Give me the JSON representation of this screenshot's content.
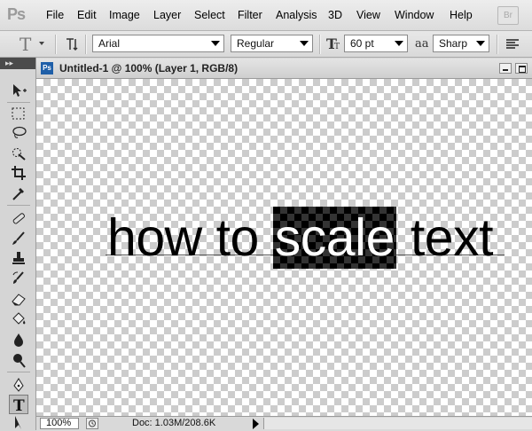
{
  "app": {
    "logo": "Ps",
    "bridge_label": "Br"
  },
  "menu": [
    "File",
    "Edit",
    "Image",
    "Layer",
    "Select",
    "Filter",
    "Analysis",
    "3D",
    "View",
    "Window",
    "Help"
  ],
  "options": {
    "font_family": "Arial",
    "font_style": "Regular",
    "font_size": "60 pt",
    "antialias_label": "aa",
    "antialias_mode": "Sharp"
  },
  "document": {
    "title": "Untitled-1 @ 100% (Layer 1, RGB/8)",
    "text_before": "how to ",
    "text_selected": "scale",
    "text_after": " text"
  },
  "status": {
    "zoom": "100%",
    "doc_size": "Doc: 1.03M/208.6K"
  },
  "colors": {
    "accent": "#1f5fa8",
    "selection": "#000000",
    "checker": "#cccccc"
  }
}
